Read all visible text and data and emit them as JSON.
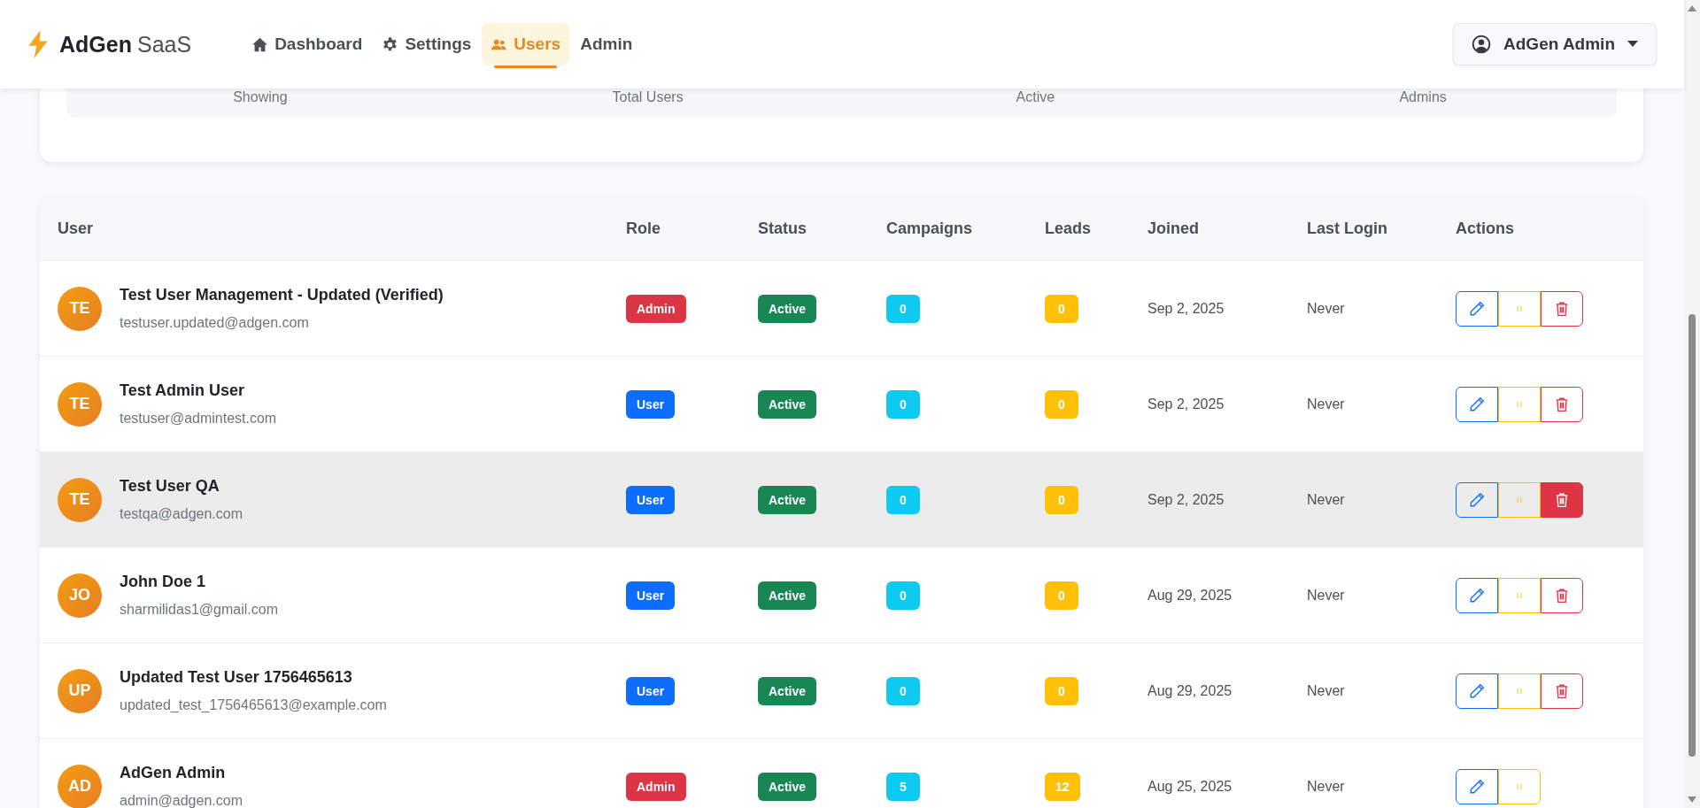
{
  "brand": {
    "name": "AdGen",
    "suffix": "SaaS"
  },
  "nav": [
    {
      "label": "Dashboard",
      "selected": false
    },
    {
      "label": "Settings",
      "selected": false
    },
    {
      "label": "Users",
      "selected": true
    },
    {
      "label": "Admin",
      "selected": false
    }
  ],
  "user_menu": {
    "label": "AdGen Admin"
  },
  "stats": [
    {
      "label": "Showing"
    },
    {
      "label": "Total Users"
    },
    {
      "label": "Active"
    },
    {
      "label": "Admins"
    }
  ],
  "table": {
    "columns": [
      "User",
      "Role",
      "Status",
      "Campaigns",
      "Leads",
      "Joined",
      "Last Login",
      "Actions"
    ],
    "rows": [
      {
        "initials": "TE",
        "name": "Test User Management - Updated (Verified)",
        "email": "testuser.updated@adgen.com",
        "role": {
          "label": "Admin",
          "color": "#dc3545"
        },
        "status": "Active",
        "campaigns": "0",
        "leads": "0",
        "joined": "Sep 2, 2025",
        "last_login": "Never",
        "highlighted": false,
        "can_delete": true
      },
      {
        "initials": "TE",
        "name": "Test Admin User",
        "email": "testuser@admintest.com",
        "role": {
          "label": "User",
          "color": "#0d6efd"
        },
        "status": "Active",
        "campaigns": "0",
        "leads": "0",
        "joined": "Sep 2, 2025",
        "last_login": "Never",
        "highlighted": false,
        "can_delete": true
      },
      {
        "initials": "TE",
        "name": "Test User QA",
        "email": "testqa@adgen.com",
        "role": {
          "label": "User",
          "color": "#0d6efd"
        },
        "status": "Active",
        "campaigns": "0",
        "leads": "0",
        "joined": "Sep 2, 2025",
        "last_login": "Never",
        "highlighted": true,
        "can_delete": true
      },
      {
        "initials": "JO",
        "name": "John Doe 1",
        "email": "sharmilidas1@gmail.com",
        "role": {
          "label": "User",
          "color": "#0d6efd"
        },
        "status": "Active",
        "campaigns": "0",
        "leads": "0",
        "joined": "Aug 29, 2025",
        "last_login": "Never",
        "highlighted": false,
        "can_delete": true
      },
      {
        "initials": "UP",
        "name": "Updated Test User 1756465613",
        "email": "updated_test_1756465613@example.com",
        "role": {
          "label": "User",
          "color": "#0d6efd"
        },
        "status": "Active",
        "campaigns": "0",
        "leads": "0",
        "joined": "Aug 29, 2025",
        "last_login": "Never",
        "highlighted": false,
        "can_delete": true
      },
      {
        "initials": "AD",
        "name": "AdGen Admin",
        "email": "admin@adgen.com",
        "role": {
          "label": "Admin",
          "color": "#dc3545"
        },
        "status": "Active",
        "campaigns": "5",
        "leads": "12",
        "joined": "Aug 25, 2025",
        "last_login": "Never",
        "highlighted": false,
        "can_delete": false
      }
    ]
  }
}
